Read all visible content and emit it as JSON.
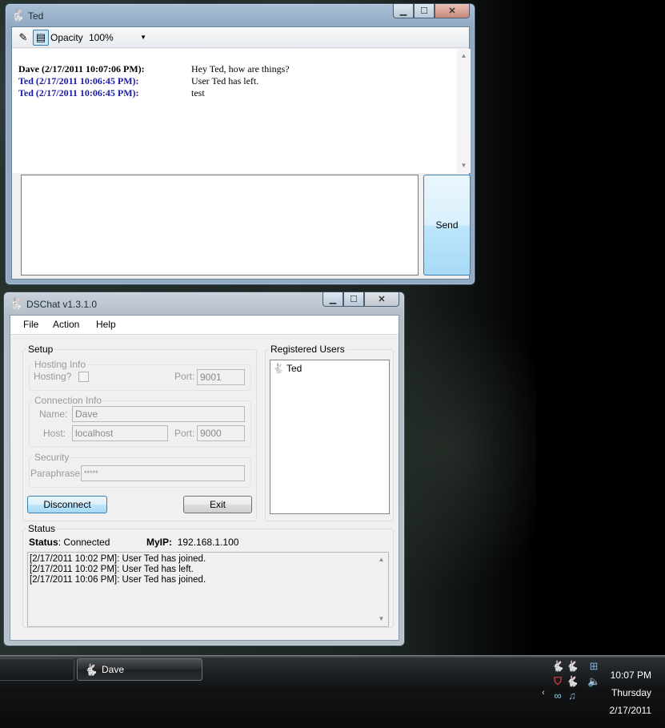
{
  "chat_window": {
    "title": "Ted",
    "toolbar": {
      "opacity_label": "Opacity",
      "opacity_value": "100%"
    },
    "messages": [
      {
        "sender": "Dave (2/17/2011 10:07:06 PM):",
        "text": "Hey Ted, how are things?",
        "style": "self"
      },
      {
        "sender": "Ted (2/17/2011 10:06:45 PM):",
        "text": "User Ted has left.",
        "style": "other"
      },
      {
        "sender": "Ted (2/17/2011 10:06:45 PM):",
        "text": "test",
        "style": "other"
      }
    ],
    "message_input_value": "",
    "send_label": "Send"
  },
  "main_window": {
    "title": "DSChat v1.3.1.0",
    "menu": [
      "File",
      "Action",
      "Help"
    ],
    "setup": {
      "legend": "Setup",
      "hosting": {
        "legend": "Hosting Info",
        "hosting_label": "Hosting?",
        "port_label": "Port:",
        "port_value": "9001"
      },
      "connection": {
        "legend": "Connection Info",
        "name_label": "Name:",
        "name_value": "Dave",
        "host_label": "Host:",
        "host_value": "localhost",
        "port_label": "Port:",
        "port_value": "9000"
      },
      "security": {
        "legend": "Security",
        "paraphrase_label": "Paraphrase:",
        "paraphrase_value": "*****"
      },
      "disconnect_label": "Disconnect",
      "exit_label": "Exit"
    },
    "registered_users": {
      "legend": "Registered Users",
      "users": [
        "Ted"
      ]
    },
    "status": {
      "legend": "Status",
      "status_label": "Status",
      "status_value": ": Connected",
      "myip_label": "MyIP:",
      "myip_value": "192.168.1.100",
      "log": [
        "[2/17/2011 10:02 PM]: User Ted has joined.",
        "[2/17/2011 10:02 PM]: User Ted has left.",
        "[2/17/2011 10:06 PM]: User Ted has joined."
      ]
    }
  },
  "taskbar": {
    "tasks": [
      "Dave"
    ],
    "clock": {
      "time": "10:07 PM",
      "day": "Thursday",
      "date": "2/17/2011"
    }
  },
  "icons": {
    "app": "bunny-icon",
    "eraser": "eraser-icon",
    "save": "save-log-icon",
    "antivirus": "antivirus-shield-icon",
    "network": "network-icon",
    "volume": "volume-icon"
  }
}
